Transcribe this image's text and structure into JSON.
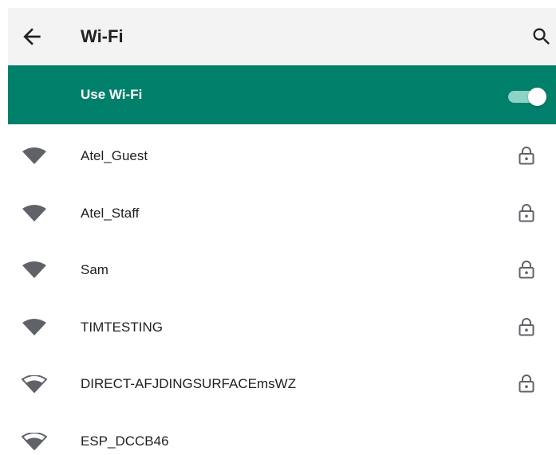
{
  "app_bar": {
    "title": "Wi-Fi",
    "back_icon": "arrow-back-icon",
    "search_icon": "search-icon"
  },
  "master_switch": {
    "label": "Use Wi-Fi",
    "enabled": true
  },
  "networks": [
    {
      "ssid": "Atel_Guest",
      "secured": true,
      "signal": "full"
    },
    {
      "ssid": "Atel_Staff",
      "secured": true,
      "signal": "full"
    },
    {
      "ssid": "Sam",
      "secured": true,
      "signal": "full"
    },
    {
      "ssid": "TIMTESTING",
      "secured": true,
      "signal": "full"
    },
    {
      "ssid": "DIRECT-AFJDINGSURFACEmsWZ",
      "secured": true,
      "signal": "medium"
    },
    {
      "ssid": "ESP_DCCB46",
      "secured": false,
      "signal": "medium"
    }
  ],
  "colors": {
    "accent": "#00806a",
    "app_bar_bg": "#f3f3f3",
    "icon": "#5f6368"
  }
}
